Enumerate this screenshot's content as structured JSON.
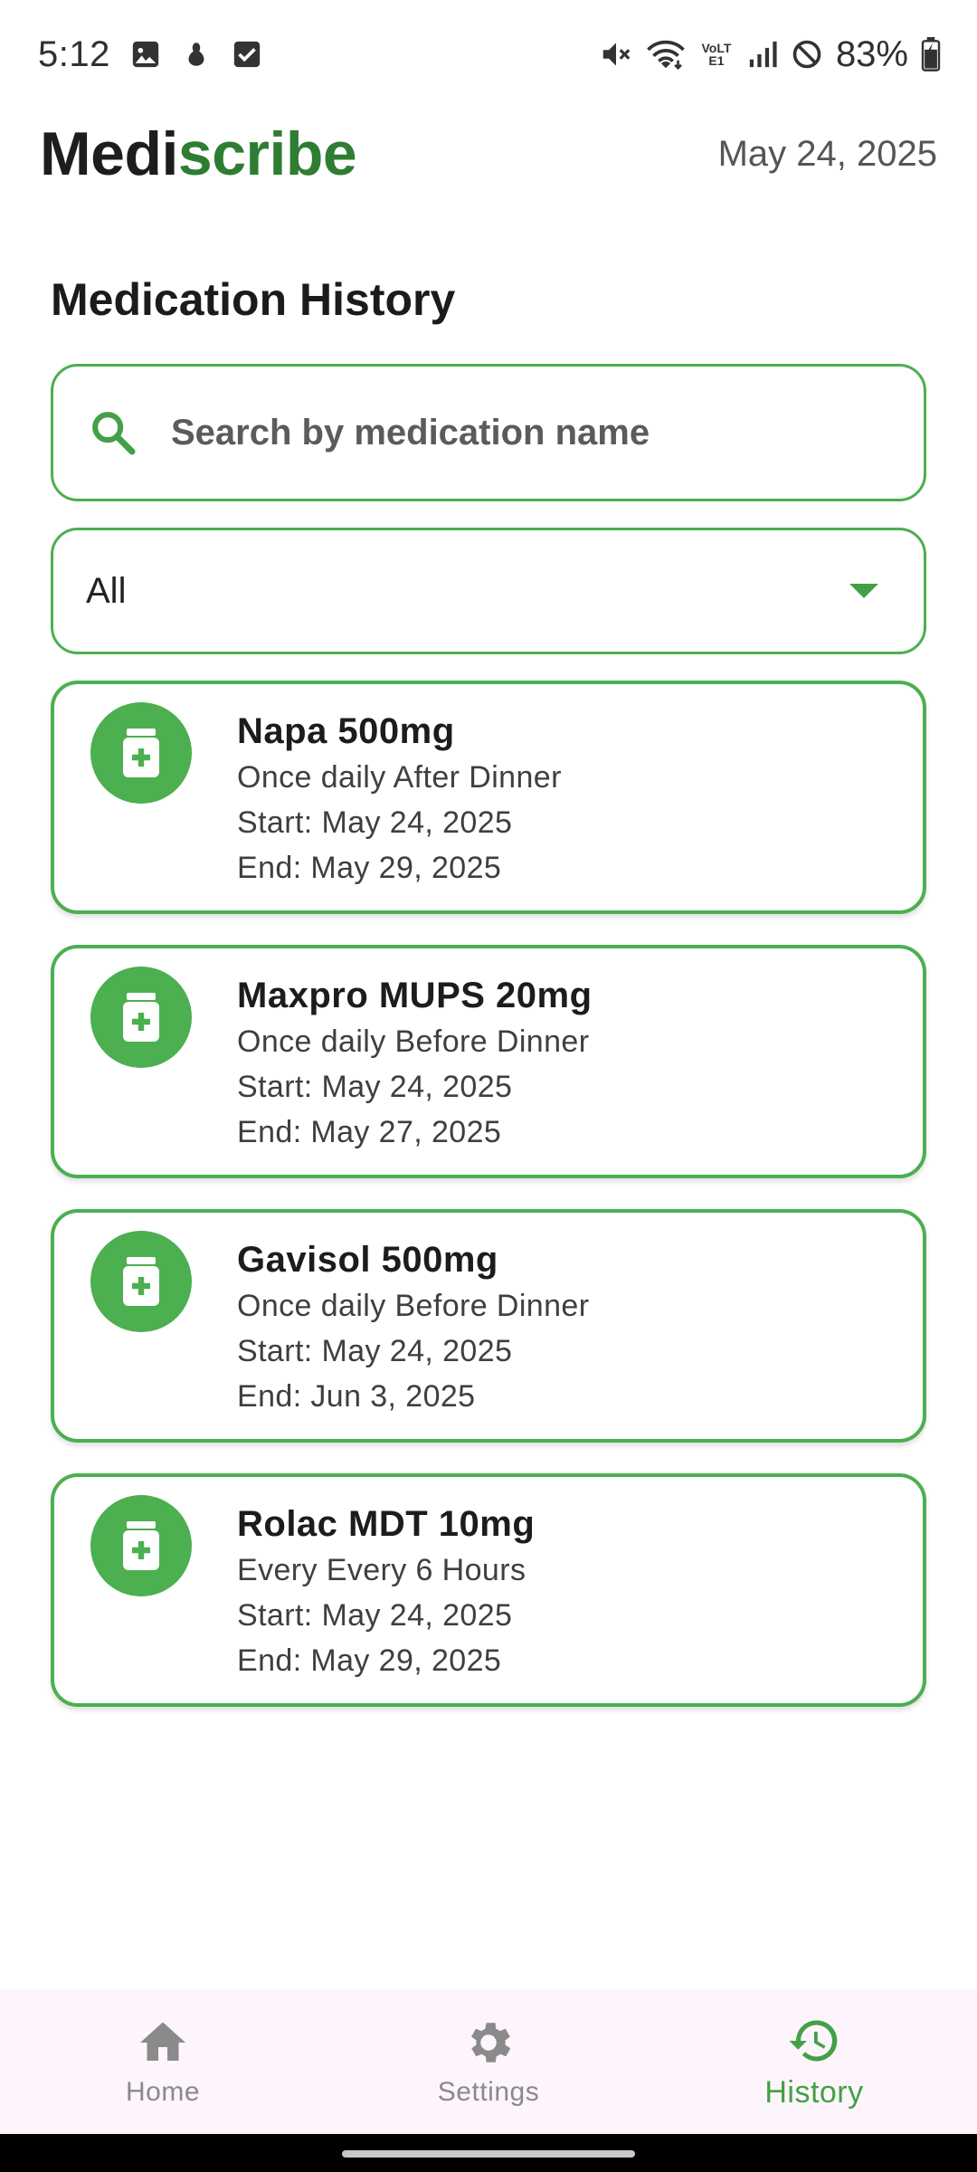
{
  "status_bar": {
    "time": "5:12",
    "battery": "83%",
    "network_label": "VoLTE1"
  },
  "header": {
    "brand_part1": "Medi",
    "brand_part2": "scribe",
    "date": "May 24, 2025"
  },
  "page": {
    "title": "Medication History"
  },
  "search": {
    "placeholder": "Search by medication name",
    "value": ""
  },
  "filter": {
    "selected": "All"
  },
  "medications": [
    {
      "name": "Napa 500mg",
      "schedule": "Once daily After Dinner",
      "start": "Start: May 24, 2025",
      "end": "End: May 29, 2025"
    },
    {
      "name": "Maxpro MUPS 20mg",
      "schedule": "Once daily Before Dinner",
      "start": "Start: May 24, 2025",
      "end": "End: May 27, 2025"
    },
    {
      "name": "Gavisol 500mg",
      "schedule": "Once daily Before Dinner",
      "start": "Start: May 24, 2025",
      "end": "End: Jun 3, 2025"
    },
    {
      "name": "Rolac MDT 10mg",
      "schedule": "Every Every 6 Hours",
      "start": "Start: May 24, 2025",
      "end": "End: May 29, 2025"
    }
  ],
  "nav": {
    "items": [
      {
        "label": "Home",
        "icon": "home-icon"
      },
      {
        "label": "Settings",
        "icon": "gear-icon"
      },
      {
        "label": "History",
        "icon": "history-icon",
        "active": true
      }
    ]
  },
  "colors": {
    "brand_green": "#2e7d32",
    "accent_green": "#4caf50",
    "nav_background": "#fdf5fb"
  }
}
